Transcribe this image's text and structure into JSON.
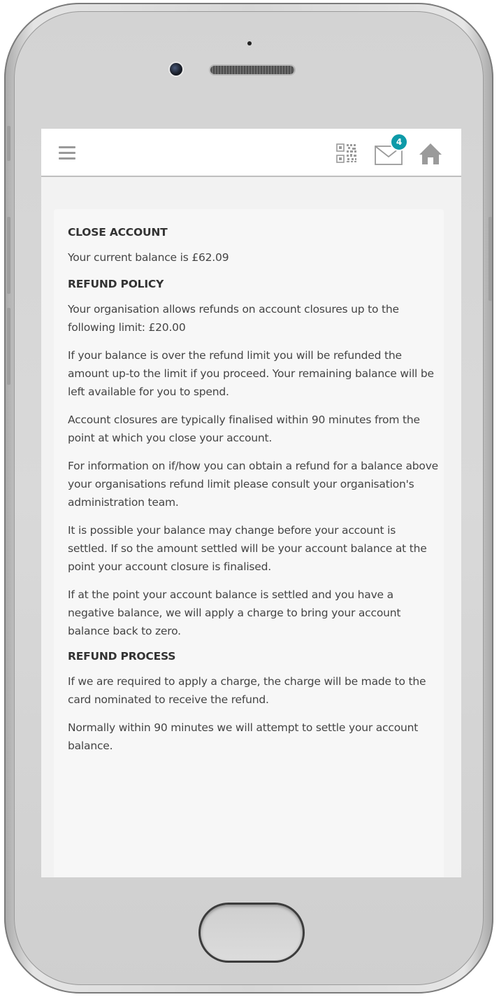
{
  "header": {
    "menu_icon": "hamburger-menu-icon",
    "qr_icon": "qr-code-icon",
    "mail_icon": "mail-icon",
    "mail_badge_count": "4",
    "home_icon": "home-icon",
    "accent_color": "#0d9aa8"
  },
  "page": {
    "title": "CLOSE ACCOUNT",
    "balance_text": "Your current balance is £62.09",
    "refund_policy_heading": "REFUND POLICY",
    "paragraphs": [
      "Your organisation allows refunds on account closures up to the following limit: £20.00",
      "If your balance is over the refund limit you will be refunded the amount up-to the limit if you proceed. Your remaining balance will be left available for you to spend.",
      "Account closures are typically finalised within 90 minutes from the point at which you close your account.",
      "For information on if/how you can obtain a refund for a balance above your organisations refund limit please consult your organisation's administration team.",
      "It is possible your balance may change before your account is settled. If so the amount settled will be your account balance at the point your account closure is finalised.",
      "If at the point your account balance is settled and you have a negative balance, we will apply a charge to bring your account balance back to zero."
    ],
    "refund_process_heading": "REFUND PROCESS",
    "process_paragraphs": [
      "If we are required to apply a charge, the charge will be made to the card nominated to receive the refund.",
      "Normally within 90 minutes we will attempt to settle your account balance."
    ]
  }
}
